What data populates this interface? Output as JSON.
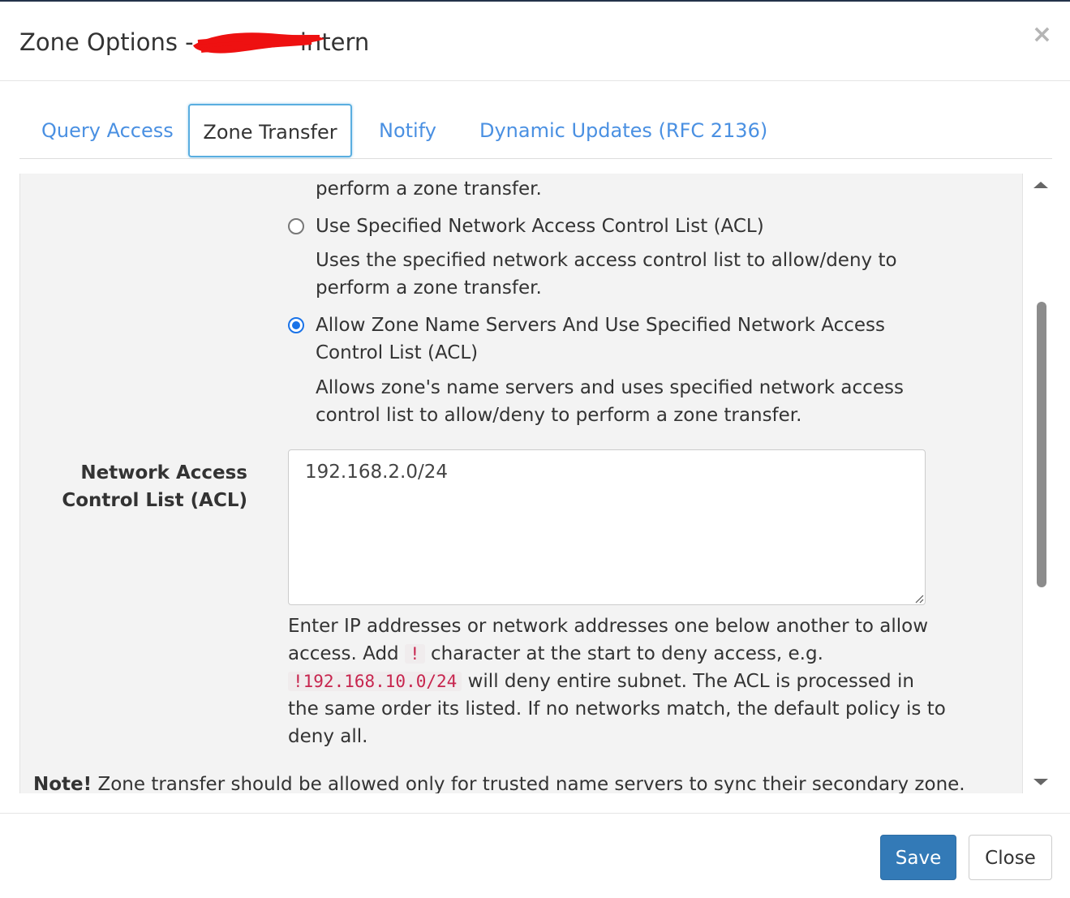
{
  "modal": {
    "title": "Zone Options - ",
    "title_suffix": "intern",
    "close_symbol": "×"
  },
  "tabs": [
    {
      "label": "Query Access",
      "active": false
    },
    {
      "label": "Zone Transfer",
      "active": true
    },
    {
      "label": "Notify",
      "active": false
    },
    {
      "label": "Dynamic Updates (RFC 2136)",
      "active": false
    }
  ],
  "content": {
    "prev_option_desc_tail": "perform a zone transfer.",
    "options": [
      {
        "label": "Use Specified Network Access Control List (ACL)",
        "desc_line1": "Uses the specified network access control list to allow/deny to",
        "desc_line2": "perform a zone transfer.",
        "checked": false
      },
      {
        "label_line1": "Allow Zone Name Servers And Use Specified Network Access",
        "label_line2": "Control List (ACL)",
        "desc_line1": "Allows zone's name servers and uses specified network access",
        "desc_line2": "control list to allow/deny to perform a zone transfer.",
        "checked": true
      }
    ],
    "acl_label_line1": "Network Access",
    "acl_label_line2": "Control List (ACL)",
    "acl_value": "192.168.2.0/24",
    "help": {
      "line1": "Enter IP addresses or network addresses one below another to allow",
      "line2_pre": "access. Add",
      "line2_code": "!",
      "line2_post": "character at the start to deny access, e.g.",
      "line3_code": "!192.168.10.0/24",
      "line3_post": "will deny entire subnet. The ACL is processed in",
      "line4": "the same order its listed. If no networks match, the default policy is to",
      "line5": "deny all."
    },
    "note_bold": "Note!",
    "note_text": "Zone transfer should be allowed only for trusted name servers to sync their secondary zone."
  },
  "footer": {
    "save_label": "Save",
    "close_label": "Close"
  },
  "colors": {
    "primary": "#337ab7",
    "link": "#4a90e2",
    "radio_checked": "#1a73e8",
    "code": "#c7254e"
  }
}
